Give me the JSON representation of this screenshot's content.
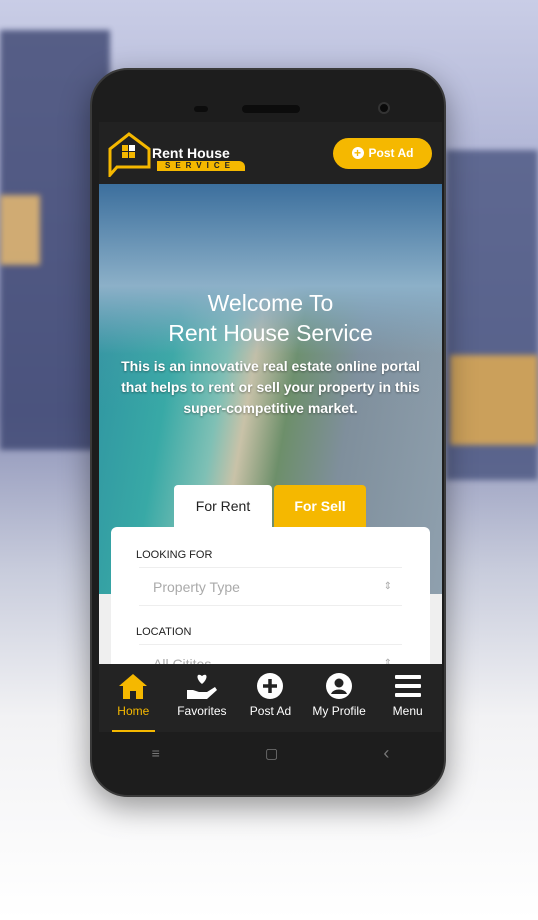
{
  "header": {
    "brand_line1": "Rent House",
    "brand_line2": "SERVICE",
    "post_ad": "Post Ad"
  },
  "hero": {
    "title_line1": "Welcome To",
    "title_line2": "Rent House Service",
    "description": "This is an innovative real estate online portal that helps to rent or sell your property in this super-competitive market."
  },
  "tabs": [
    {
      "label": "For Rent",
      "active": true
    },
    {
      "label": "For Sell",
      "active": false
    }
  ],
  "search": {
    "looking_for_label": "LOOKING FOR",
    "property_placeholder": "Property Type",
    "location_label": "LOCATION",
    "location_placeholder": "All Citites"
  },
  "bottom_nav": [
    {
      "label": "Home",
      "icon": "home-icon",
      "active": true
    },
    {
      "label": "Favorites",
      "icon": "heart-hand-icon"
    },
    {
      "label": "Post Ad",
      "icon": "plus-circle-icon"
    },
    {
      "label": "My Profile",
      "icon": "user-circle-icon"
    },
    {
      "label": "Menu",
      "icon": "menu-icon"
    }
  ],
  "system_nav": {
    "recents": "≡",
    "home": "▢",
    "back": "‹"
  },
  "colors": {
    "accent": "#f5b800",
    "header_bg": "#222222"
  }
}
